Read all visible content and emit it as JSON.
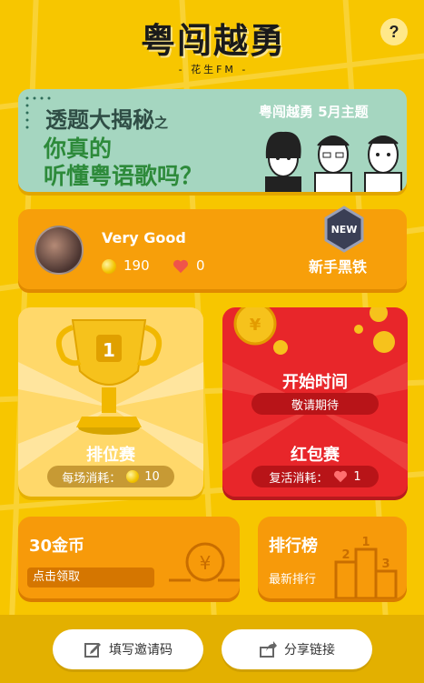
{
  "header": {
    "title": "粤闯越勇",
    "subtitle": "- 花生FM -",
    "help_label": "?"
  },
  "banner": {
    "line1": "透题大揭秘",
    "line1_suffix": "之",
    "line2": "你真的",
    "line3": "听懂粤语歌吗？",
    "theme": "粤闯越勇 5月主题"
  },
  "profile": {
    "username": "Very Good",
    "coins": "190",
    "hearts": "0",
    "badge": "NEW",
    "rank_title": "新手黑铁"
  },
  "ranked_mode": {
    "title": "排位赛",
    "cost_label": "每场消耗：",
    "cost_value": "10"
  },
  "redpacket_mode": {
    "start_label": "开始时间",
    "start_value": "敬请期待",
    "title": "红包赛",
    "revive_label": "复活消耗：",
    "revive_value": "1"
  },
  "coins_card": {
    "title": "30金币",
    "action": "点击领取"
  },
  "leaderboard_card": {
    "title": "排行榜",
    "subtitle": "最新排行",
    "podium": [
      "2",
      "1",
      "3"
    ]
  },
  "footer": {
    "invite_label": "填写邀请码",
    "share_label": "分享链接"
  },
  "colors": {
    "background": "#f7c600",
    "orange_card": "#f79f0a",
    "red_card": "#e8262a",
    "rank_card": "#ffd86a",
    "banner": "#a5d6c0"
  },
  "icons": [
    "question-icon",
    "coin-icon",
    "heart-icon",
    "new-badge-icon",
    "trophy-icon",
    "coin-stack-icon",
    "podium-icon",
    "edit-icon",
    "share-icon"
  ]
}
